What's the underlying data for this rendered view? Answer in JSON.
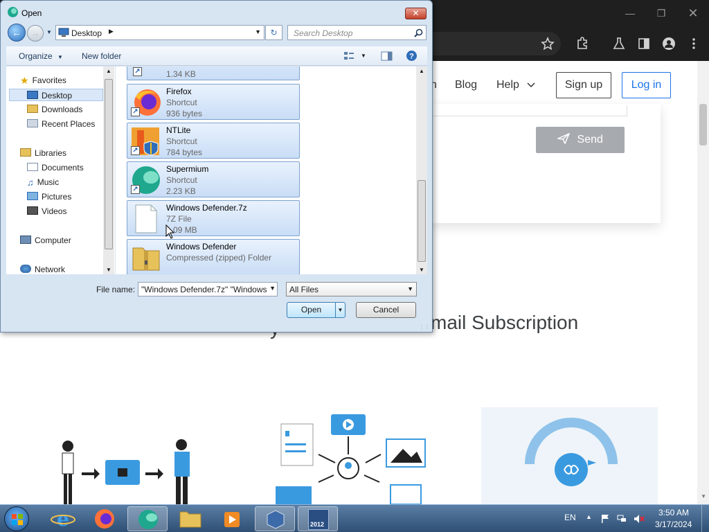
{
  "browser": {
    "nav": {
      "partial_link": "n",
      "blog": "Blog",
      "help": "Help",
      "sign_up": "Sign up",
      "log_in": "Log in"
    },
    "send_button": "Send",
    "heading": "mail Subscription",
    "heading_partial_char": "y"
  },
  "dialog": {
    "title": "Open",
    "address": {
      "location": "Desktop"
    },
    "search_placeholder": "Search Desktop",
    "toolbar": {
      "organize": "Organize",
      "new_folder": "New folder"
    },
    "nav_tree": {
      "favorites": "Favorites",
      "desktop": "Desktop",
      "downloads": "Downloads",
      "recent_places": "Recent Places",
      "libraries": "Libraries",
      "documents": "Documents",
      "music": "Music",
      "pictures": "Pictures",
      "videos": "Videos",
      "computer": "Computer",
      "network": "Network"
    },
    "files": [
      {
        "name": "",
        "type": "",
        "size": "1.34 KB"
      },
      {
        "name": "Firefox",
        "type": "Shortcut",
        "size": "936 bytes"
      },
      {
        "name": "NTLite",
        "type": "Shortcut",
        "size": "784 bytes"
      },
      {
        "name": "Supermium",
        "type": "Shortcut",
        "size": "2.23 KB"
      },
      {
        "name": "Windows Defender.7z",
        "type": "7Z File",
        "size": "1.09 MB"
      },
      {
        "name": "Windows Defender",
        "type": "Compressed (zipped) Folder",
        "size": ""
      }
    ],
    "file_name_label": "File name:",
    "file_name_value": "\"Windows Defender.7z\" \"Windows",
    "file_type": "All Files",
    "open_button": "Open",
    "cancel_button": "Cancel"
  },
  "taskbar": {
    "language": "EN",
    "time": "3:50 AM",
    "date": "3/17/2024",
    "vbox_label": "2012"
  },
  "colors": {
    "dialog_bg": "#d7e4f2",
    "selection": "#c9ddf6",
    "taskbar": "#3d5f86",
    "link_blue": "#1a73e8"
  }
}
